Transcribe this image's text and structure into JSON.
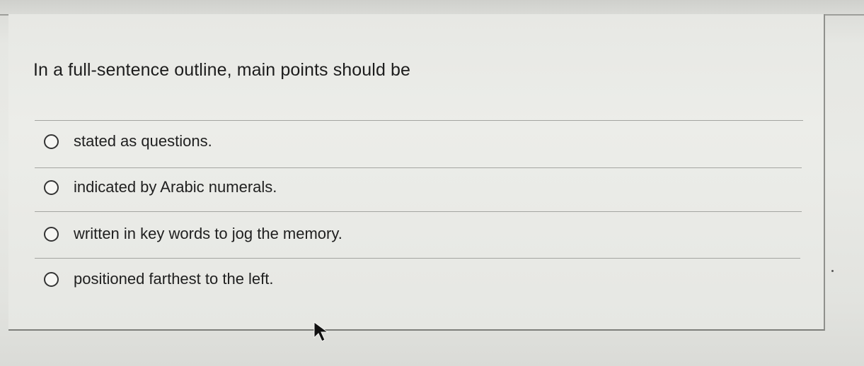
{
  "question": {
    "prompt": "In a full-sentence outline, main points should be",
    "options": [
      {
        "label": "stated as questions.",
        "selected": false
      },
      {
        "label": "indicated by Arabic numerals.",
        "selected": false
      },
      {
        "label": "written in key words to jog the memory.",
        "selected": false
      },
      {
        "label": "positioned farthest to the left.",
        "selected": false
      }
    ]
  },
  "icons": {
    "radio": "radio-button-icon",
    "cursor": "mouse-cursor-icon"
  },
  "colors": {
    "background": "#dfe0dc",
    "card": "#ecede9",
    "text": "#1d1d1d",
    "divider": "#a4a5a1"
  }
}
